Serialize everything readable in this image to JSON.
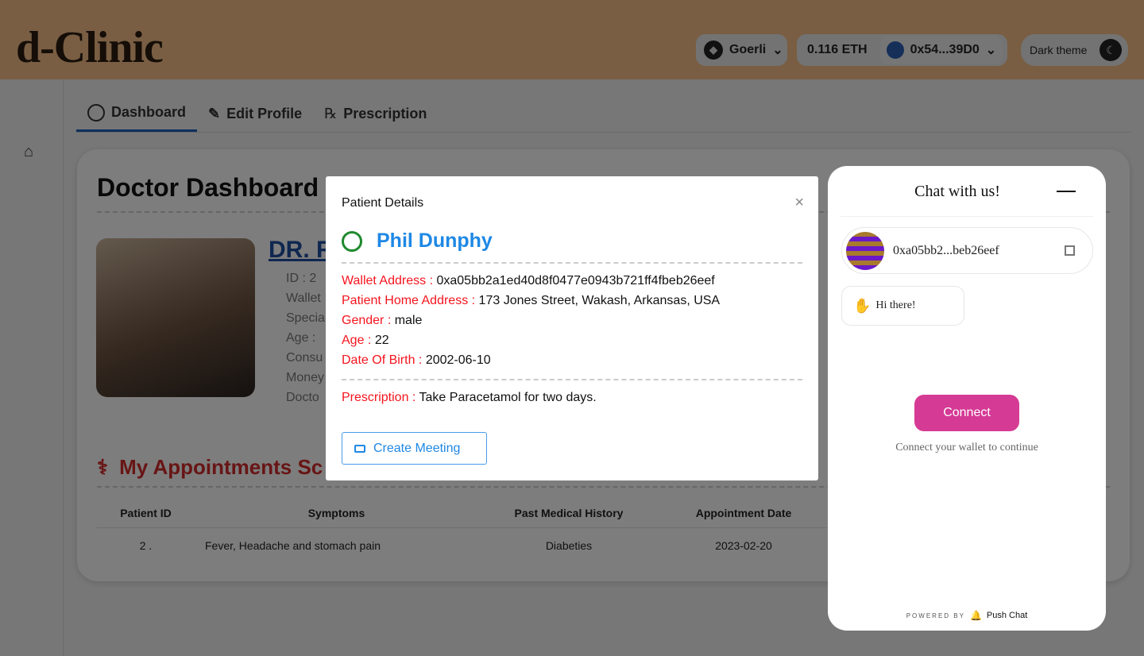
{
  "header": {
    "logo": "d-Clinic",
    "network": "Goerli",
    "balance": "0.116 ETH",
    "account": "0x54...39D0",
    "theme_label": "Dark theme"
  },
  "tabs": [
    {
      "label": "Dashboard"
    },
    {
      "label": "Edit Profile"
    },
    {
      "label": "Prescription"
    }
  ],
  "dashboard": {
    "title": "Doctor Dashboard",
    "doctor_name": "DR. R",
    "info": [
      "ID : 2",
      "Wallet",
      "Specia",
      "Age : ",
      "Consu",
      "Money",
      "Docto"
    ],
    "appointments_title": "My Appointments Sc",
    "table": {
      "headers": [
        "Patient ID",
        "Symptoms",
        "Past Medical History",
        "Appointment Date"
      ],
      "rows": [
        [
          "2 .",
          "Fever, Headache and stomach pain",
          "Diabeties",
          "2023-02-20"
        ]
      ]
    }
  },
  "modal": {
    "title": "Patient Details",
    "patient_name": "Phil Dunphy",
    "fields": [
      {
        "label": "Wallet Address :",
        "value": "0xa05bb2a1ed40d8f0477e0943b721ff4fbeb26eef"
      },
      {
        "label": "Patient Home Address :",
        "value": "173 Jones Street, Wakash, Arkansas, USA"
      },
      {
        "label": "Gender :",
        "value": "male"
      },
      {
        "label": "Age :",
        "value": "22"
      },
      {
        "label": "Date Of Birth :",
        "value": "2002-06-10"
      }
    ],
    "prescription": {
      "label": "Prescription :",
      "value": "Take Paracetamol for two days."
    },
    "create_meeting": "Create Meeting"
  },
  "chat": {
    "title": "Chat with us!",
    "address": "0xa05bb2...beb26eef",
    "greeting": "Hi there!",
    "connect": "Connect",
    "connect_hint": "Connect your wallet to continue",
    "powered_by": "POWERED BY",
    "brand": "Push Chat",
    "accent": "#d53a94"
  }
}
